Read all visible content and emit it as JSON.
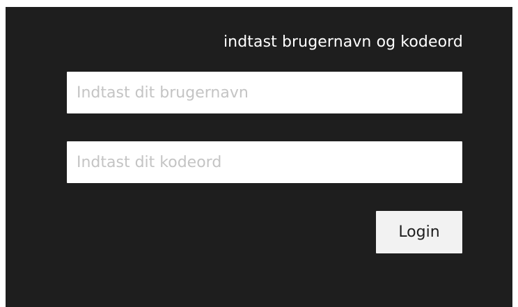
{
  "login": {
    "heading": "indtast brugernavn og kodeord",
    "username": {
      "value": "",
      "placeholder": "Indtast dit brugernavn"
    },
    "password": {
      "value": "",
      "placeholder": "Indtast dit kodeord"
    },
    "button_label": "Login"
  },
  "colors": {
    "panel_background": "#1e1e1e",
    "field_background": "#ffffff",
    "placeholder_text": "#c4c4c4",
    "button_background": "#f2f2f2",
    "heading_text": "#ffffff"
  }
}
